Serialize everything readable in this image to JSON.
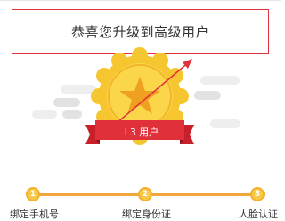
{
  "banner": {
    "message": "恭喜您升级到高级用户"
  },
  "badge": {
    "level_label": "L3 用户"
  },
  "steps": [
    {
      "number": "1",
      "label": "绑定手机号"
    },
    {
      "number": "2",
      "label": "绑定身份证"
    },
    {
      "number": "3",
      "label": "人脸认证"
    }
  ],
  "colors": {
    "accent_red": "#e0303a",
    "gold": "#f7c948",
    "progress": "#f0a63b"
  }
}
